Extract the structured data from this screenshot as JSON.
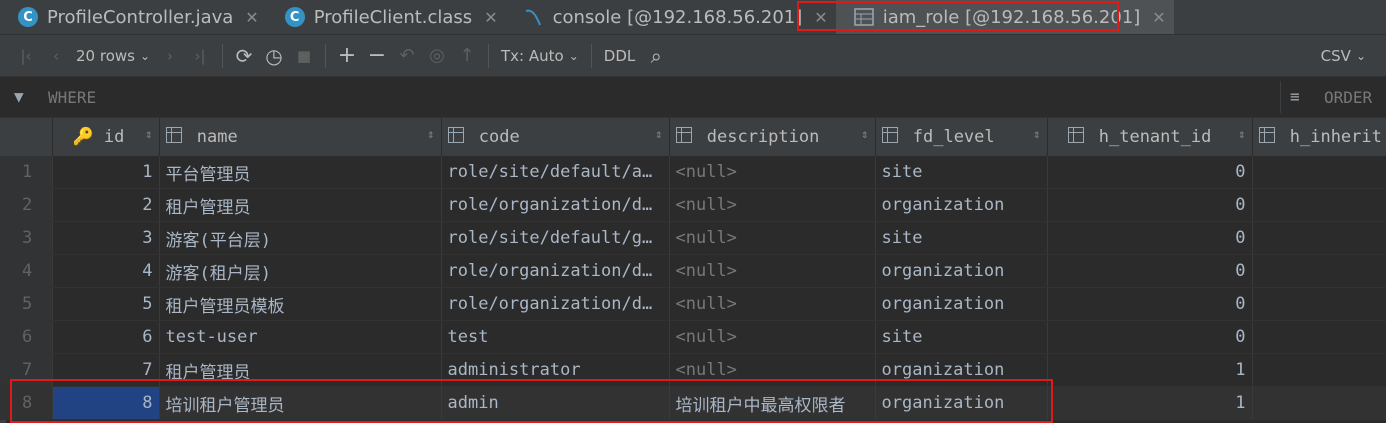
{
  "tabs": [
    {
      "label": "ProfileController.java",
      "icon": "class-c-icon"
    },
    {
      "label": "ProfileClient.class",
      "icon": "class-c-icon"
    },
    {
      "label": "console [@192.168.56.201]",
      "icon": "console-icon"
    },
    {
      "label": "iam_role [@192.168.56.201]",
      "icon": "table-icon"
    }
  ],
  "toolbar": {
    "rows_label": "20 rows",
    "tx_label": "Tx: Auto",
    "ddl_label": "DDL",
    "export_label": "CSV"
  },
  "filter": {
    "where_label": "WHERE",
    "order_label": "ORDER"
  },
  "columns": [
    "id",
    "name",
    "code",
    "description",
    "fd_level",
    "h_tenant_id",
    "h_inherit"
  ],
  "rows": [
    {
      "n": "1",
      "id": "1",
      "name": "平台管理员",
      "code": "role/site/default/a…",
      "description": "<null>",
      "fd_level": "site",
      "h_tenant_id": "0"
    },
    {
      "n": "2",
      "id": "2",
      "name": "租户管理员",
      "code": "role/organization/d…",
      "description": "<null>",
      "fd_level": "organization",
      "h_tenant_id": "0"
    },
    {
      "n": "3",
      "id": "3",
      "name": "游客(平台层)",
      "code": "role/site/default/g…",
      "description": "<null>",
      "fd_level": "site",
      "h_tenant_id": "0"
    },
    {
      "n": "4",
      "id": "4",
      "name": "游客(租户层)",
      "code": "role/organization/d…",
      "description": "<null>",
      "fd_level": "organization",
      "h_tenant_id": "0"
    },
    {
      "n": "5",
      "id": "5",
      "name": "租户管理员模板",
      "code": "role/organization/d…",
      "description": "<null>",
      "fd_level": "organization",
      "h_tenant_id": "0"
    },
    {
      "n": "6",
      "id": "6",
      "name": "test-user",
      "code": "test",
      "description": "<null>",
      "fd_level": "site",
      "h_tenant_id": "0"
    },
    {
      "n": "7",
      "id": "7",
      "name": "租户管理员",
      "code": "administrator",
      "description": "<null>",
      "fd_level": "organization",
      "h_tenant_id": "1"
    },
    {
      "n": "8",
      "id": "8",
      "name": "培训租户管理员",
      "code": "admin",
      "description": "培训租户中最高权限者",
      "fd_level": "organization",
      "h_tenant_id": "1"
    }
  ],
  "colors": {
    "highlight": "#e01919",
    "selection": "#214283"
  }
}
